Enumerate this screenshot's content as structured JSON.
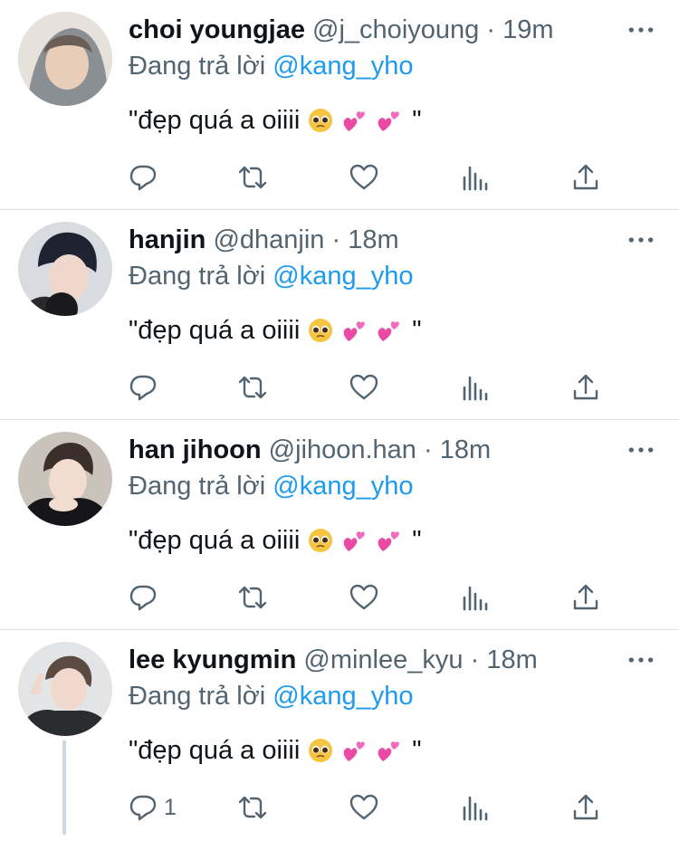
{
  "theme": {
    "accent": "#1d9bf0",
    "text": "#0f1419",
    "muted": "#536471",
    "divider": "#dde1e4"
  },
  "tweets": [
    {
      "name": "choi youngjae",
      "handle": "@j_choiyoung",
      "separator": "·",
      "time": "19m",
      "reply_prefix": "Đang trả lời",
      "reply_to": "@kang_yho",
      "text": "\"đẹp quá a oiiii",
      "text_suffix": "\"",
      "emojis": [
        "pleading-face-emoji",
        "two-hearts-emoji",
        "two-hearts-emoji"
      ],
      "reply_count": "",
      "icons": [
        "reply-icon",
        "retweet-icon",
        "like-icon",
        "analytics-icon",
        "share-icon"
      ]
    },
    {
      "name": "hanjin",
      "handle": "@dhanjin",
      "separator": "·",
      "time": "18m",
      "reply_prefix": "Đang trả lời",
      "reply_to": "@kang_yho",
      "text": "\"đẹp quá a oiiii",
      "text_suffix": "\"",
      "emojis": [
        "pleading-face-emoji",
        "two-hearts-emoji",
        "two-hearts-emoji"
      ],
      "reply_count": "",
      "icons": [
        "reply-icon",
        "retweet-icon",
        "like-icon",
        "analytics-icon",
        "share-icon"
      ]
    },
    {
      "name": "han jihoon",
      "handle": "@jihoon.han",
      "separator": "·",
      "time": "18m",
      "reply_prefix": "Đang trả lời",
      "reply_to": "@kang_yho",
      "text": "\"đẹp quá a oiiii",
      "text_suffix": "\"",
      "emojis": [
        "pleading-face-emoji",
        "two-hearts-emoji",
        "two-hearts-emoji"
      ],
      "reply_count": "",
      "icons": [
        "reply-icon",
        "retweet-icon",
        "like-icon",
        "analytics-icon",
        "share-icon"
      ]
    },
    {
      "name": "lee kyungmin",
      "handle": "@minlee_kyu",
      "separator": "·",
      "time": "18m",
      "reply_prefix": "Đang trả lời",
      "reply_to": "@kang_yho",
      "text": "\"đẹp quá a oiiii",
      "text_suffix": "\"",
      "emojis": [
        "pleading-face-emoji",
        "two-hearts-emoji",
        "two-hearts-emoji"
      ],
      "reply_count": "1",
      "icons": [
        "reply-icon",
        "retweet-icon",
        "like-icon",
        "analytics-icon",
        "share-icon"
      ]
    }
  ]
}
